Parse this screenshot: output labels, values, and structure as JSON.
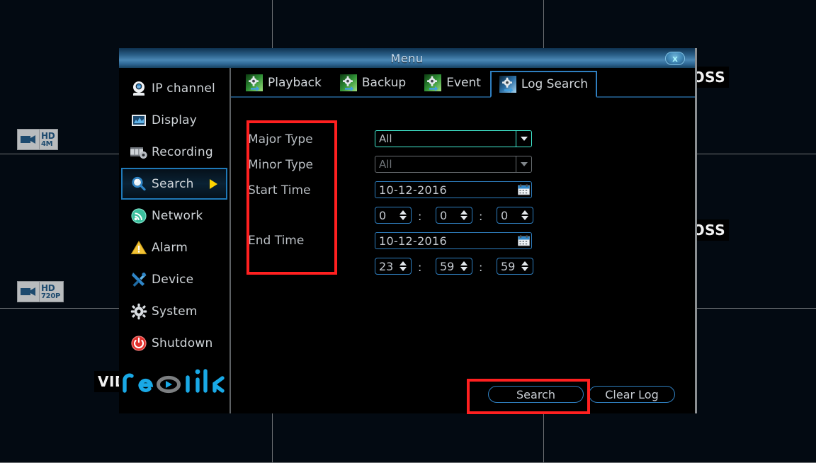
{
  "background": {
    "badges": [
      {
        "name": "hd-4m-badge",
        "line1": "HD",
        "line2": "4M",
        "icon": "camera-icon"
      },
      {
        "name": "hd-720p-badge",
        "line1": "HD",
        "line2": "720P",
        "icon": "camera-icon"
      }
    ],
    "video_loss_labels": [
      "VIDEO LOSS",
      "VIDEO LOSS",
      "VIDEO LOSS"
    ],
    "loss_text": "VIDEO LOSS",
    "partial_left": "VID",
    "partial_right": "OSS"
  },
  "dialog": {
    "title": "Menu",
    "close_icon": "close-icon",
    "close_label": "x"
  },
  "sidebar": {
    "items": [
      {
        "label": "IP channel",
        "icon": "ip-camera-icon",
        "active": false
      },
      {
        "label": "Display",
        "icon": "display-icon",
        "active": false
      },
      {
        "label": "Recording",
        "icon": "recording-icon",
        "active": false
      },
      {
        "label": "Search",
        "icon": "magnifier-icon",
        "active": true
      },
      {
        "label": "Network",
        "icon": "network-icon",
        "active": false
      },
      {
        "label": "Alarm",
        "icon": "warning-triangle-icon",
        "active": false
      },
      {
        "label": "Device",
        "icon": "tools-icon",
        "active": false
      },
      {
        "label": "System",
        "icon": "gear-icon",
        "active": false
      },
      {
        "label": "Shutdown",
        "icon": "power-icon",
        "active": false
      }
    ],
    "brand": "reolink"
  },
  "tabs": [
    {
      "label": "Playback",
      "icon": "gear-arrow-icon",
      "active": false
    },
    {
      "label": "Backup",
      "icon": "gear-arrow-icon",
      "active": false
    },
    {
      "label": "Event",
      "icon": "gear-arrow-icon",
      "active": false
    },
    {
      "label": "Log Search",
      "icon": "gear-arrow-icon",
      "active": true
    }
  ],
  "form": {
    "labels": {
      "major_type": "Major Type",
      "minor_type": "Minor Type",
      "start_time": "Start Time",
      "end_time": "End Time"
    },
    "major_type": {
      "value": "All",
      "options": [
        "All"
      ],
      "enabled": true
    },
    "minor_type": {
      "value": "All",
      "options": [
        "All"
      ],
      "enabled": false
    },
    "start_date": {
      "value": "10-12-2016",
      "icon": "calendar-icon"
    },
    "start_hour": "0",
    "start_minute": "0",
    "start_second": "0",
    "end_date": {
      "value": "10-12-2016",
      "icon": "calendar-icon"
    },
    "end_hour": "23",
    "end_minute": "59",
    "end_second": "59",
    "time_separator": ":"
  },
  "buttons": {
    "search": "Search",
    "clear_log": "Clear Log"
  },
  "annotations": {
    "highlight_color": "#ff2020",
    "boxes": [
      "labels-column-highlight",
      "search-button-highlight"
    ]
  }
}
